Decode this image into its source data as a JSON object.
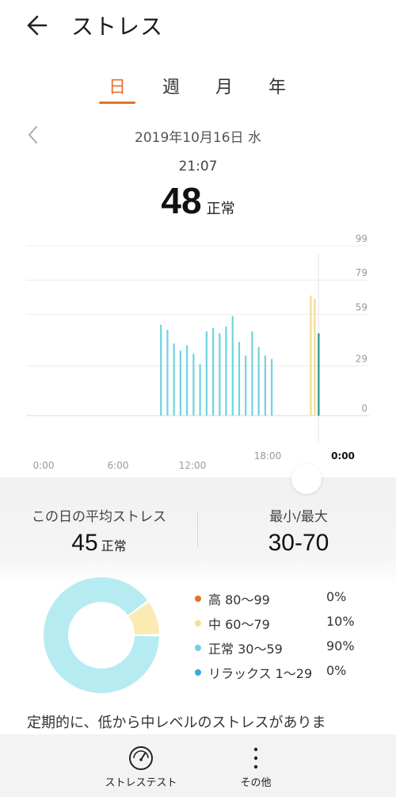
{
  "header": {
    "title": "ストレス",
    "back_icon": "arrow-left-icon"
  },
  "tabs": [
    {
      "label": "日",
      "active": true
    },
    {
      "label": "週",
      "active": false
    },
    {
      "label": "月",
      "active": false
    },
    {
      "label": "年",
      "active": false
    }
  ],
  "date": {
    "text": "2019年10月16日 水",
    "prev_icon": "chevron-left-icon"
  },
  "current": {
    "time": "21:07",
    "value": "48",
    "status": "正常"
  },
  "chart_data": {
    "type": "bar",
    "y_ticks": [
      "99",
      "79",
      "59",
      "29",
      "0"
    ],
    "x_labels": [
      "0:00",
      "6:00",
      "12:00",
      "18:00",
      "0:00"
    ],
    "ylim": [
      0,
      99
    ],
    "grid": true,
    "colors": {
      "normal": "#6fd3df",
      "medium": "#f4dc8a",
      "selected": "#2f8f86"
    },
    "bars": [
      {
        "t": 9.0,
        "v": 53,
        "level": "normal"
      },
      {
        "t": 9.5,
        "v": 50,
        "level": "normal"
      },
      {
        "t": 10.0,
        "v": 42,
        "level": "normal"
      },
      {
        "t": 10.5,
        "v": 38,
        "level": "normal"
      },
      {
        "t": 11.0,
        "v": 41,
        "level": "normal"
      },
      {
        "t": 11.5,
        "v": 36,
        "level": "normal"
      },
      {
        "t": 12.0,
        "v": 30,
        "level": "normal"
      },
      {
        "t": 12.5,
        "v": 49,
        "level": "normal"
      },
      {
        "t": 13.0,
        "v": 51,
        "level": "normal"
      },
      {
        "t": 13.5,
        "v": 48,
        "level": "normal"
      },
      {
        "t": 14.0,
        "v": 52,
        "level": "normal"
      },
      {
        "t": 14.5,
        "v": 58,
        "level": "normal"
      },
      {
        "t": 15.0,
        "v": 43,
        "level": "normal"
      },
      {
        "t": 15.5,
        "v": 35,
        "level": "normal"
      },
      {
        "t": 16.0,
        "v": 49,
        "level": "normal"
      },
      {
        "t": 16.5,
        "v": 40,
        "level": "normal"
      },
      {
        "t": 17.0,
        "v": 35,
        "level": "normal"
      },
      {
        "t": 17.5,
        "v": 33,
        "level": "normal"
      },
      {
        "t": 20.5,
        "v": 70,
        "level": "medium"
      },
      {
        "t": 20.8,
        "v": 68,
        "level": "medium"
      },
      {
        "t": 21.1,
        "v": 48,
        "level": "selected"
      }
    ],
    "cursor_t": 21.1
  },
  "summary": {
    "avg_label": "この日の平均ストレス",
    "avg_value": "45",
    "avg_status": "正常",
    "minmax_label": "最小/最大",
    "minmax_value": "30-70"
  },
  "distribution": [
    {
      "label": "高 80～99",
      "pct": "0%",
      "fraction": 0.0,
      "color": "#e8702a"
    },
    {
      "label": "中 60～79",
      "pct": "10%",
      "fraction": 0.1,
      "color": "#f6df8e"
    },
    {
      "label": "正常 30～59",
      "pct": "90%",
      "fraction": 0.9,
      "color": "#6fd3df"
    },
    {
      "label": "リラックス 1～29",
      "pct": "0%",
      "fraction": 0.0,
      "color": "#3aa5e2"
    }
  ],
  "donut_colors": {
    "medium_fill": "#fbeab3",
    "normal_fill": "#b6ecf1",
    "inner": "#ffffff"
  },
  "message": "定期的に、低から中レベルのストレスがありま",
  "bottom_bar": {
    "stress_test_label": "ストレステスト",
    "stress_test_icon": "gauge-icon",
    "more_label": "その他",
    "more_icon": "more-vertical-icon"
  }
}
